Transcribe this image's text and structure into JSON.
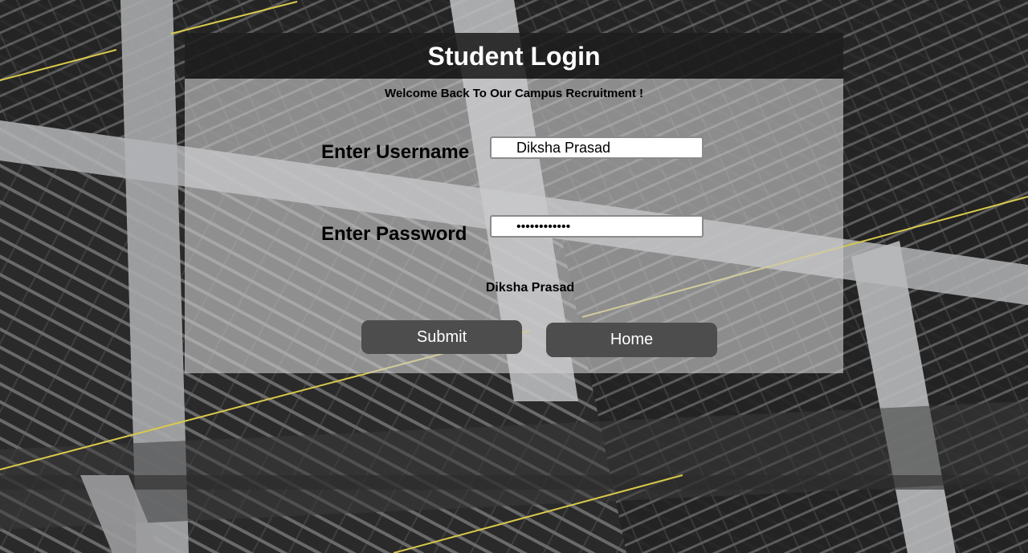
{
  "page": {
    "title": "Student Login",
    "welcome": "Welcome Back To Our Campus Recruitment !"
  },
  "form": {
    "username_label": "Enter Username",
    "username_value": "Diksha Prasad",
    "password_label": "Enter Password",
    "password_value": "••••••••••••",
    "status_text": "Diksha Prasad"
  },
  "buttons": {
    "submit": "Submit",
    "home": "Home"
  },
  "colors": {
    "header_bg": "#1e1e1e",
    "button_bg": "#4d4d4d",
    "accent_line": "#d8c94a"
  }
}
